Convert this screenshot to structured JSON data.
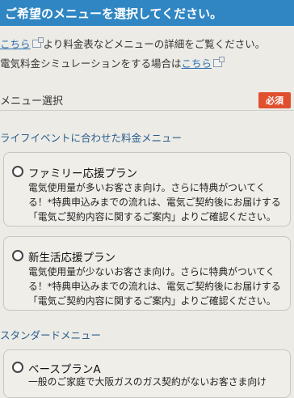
{
  "header": {
    "title": "ご希望のメニューを選択してください。"
  },
  "intro": {
    "line1_link": "こちら",
    "line1_text": "より料金表などメニューの詳細をご覧ください。",
    "line2_text": "電気料金シミュレーションをする場合は",
    "line2_link": "こちら"
  },
  "section": {
    "title": "メニュー選択",
    "required_badge": "必須"
  },
  "groups": [
    {
      "label": "ライフイベントに合わせた料金メニュー",
      "plans": [
        {
          "name": "ファミリー応援プラン",
          "description": "電気使用量が多いお客さま向け。さらに特典がついてくる！*特典申込みまでの流れは、電気ご契約後にお届けする「電気ご契約内容に関するご案内」よりご確認ください。"
        },
        {
          "name": "新生活応援プラン",
          "description": "電気使用量が少ないお客さま向け。さらに特典がついてくる！*特典申込みまでの流れは、電気ご契約後にお届けする「電気ご契約内容に関するご案内」よりご確認ください。"
        }
      ]
    },
    {
      "label": "スタンダードメニュー",
      "plans": [
        {
          "name": "ベースプランA",
          "description": "一般のご家庭で大阪ガスのガス契約がないお客さま向け"
        }
      ]
    }
  ],
  "colors": {
    "header_bg": "#2f86c3",
    "badge_bg": "#e0502e",
    "link": "#2a6fb0"
  }
}
